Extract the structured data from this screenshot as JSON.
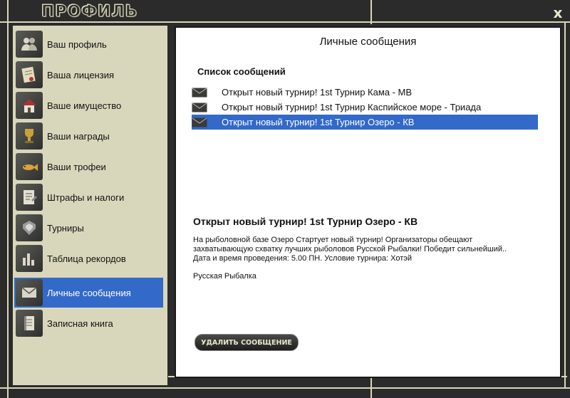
{
  "window": {
    "title": "ПРОФИЛЬ",
    "close_label": "x"
  },
  "sidebar": {
    "items": [
      {
        "label": "Ваш профиль",
        "icon": "users-icon"
      },
      {
        "label": "Ваша лицензия",
        "icon": "license-icon"
      },
      {
        "label": "Ваше имущество",
        "icon": "house-icon"
      },
      {
        "label": "Ваши награды",
        "icon": "trophy-icon"
      },
      {
        "label": "Ваши трофеи",
        "icon": "fish-icon"
      },
      {
        "label": "Штрафы и налоги",
        "icon": "document-icon"
      },
      {
        "label": "Турниры",
        "icon": "tournament-icon"
      },
      {
        "label": "Таблица рекордов",
        "icon": "bar-chart-icon"
      },
      {
        "label": "Личные сообщения",
        "icon": "envelope-icon"
      },
      {
        "label": "Записная книга",
        "icon": "notebook-icon"
      }
    ],
    "active_index": 8
  },
  "main": {
    "title": "Личные сообщения",
    "list_title": "Список сообщений",
    "messages": [
      {
        "text": "Открыт новый турнир! 1st Турнир Кама - МВ"
      },
      {
        "text": "Открыт новый турнир! 1st Турнир Каспийское море - Триада"
      },
      {
        "text": "Открыт новый турнир! 1st Турнир Озеро - КВ"
      }
    ],
    "selected_index": 2,
    "detail": {
      "title": "Открыт новый турнир! 1st Турнир Озеро - КВ",
      "body_line1": "На рыболовной базе Озеро Стартует новый турнир! Организаторы обещают",
      "body_line2": "захватывающую схватку лучших рыболовов Русской Рыбалки! Победит сильнейший..",
      "body_line3": "Дата и время проведения: 5.00 ПН. Условие турнира: Хотэй",
      "signature": "Русская Рыбалка"
    },
    "delete_button": "УДАЛИТЬ СООБЩЕНИЕ"
  },
  "colors": {
    "accent": "#3369c9",
    "sidebar_bg": "#d9d7bb",
    "frame_bg": "#2b2b2b"
  }
}
